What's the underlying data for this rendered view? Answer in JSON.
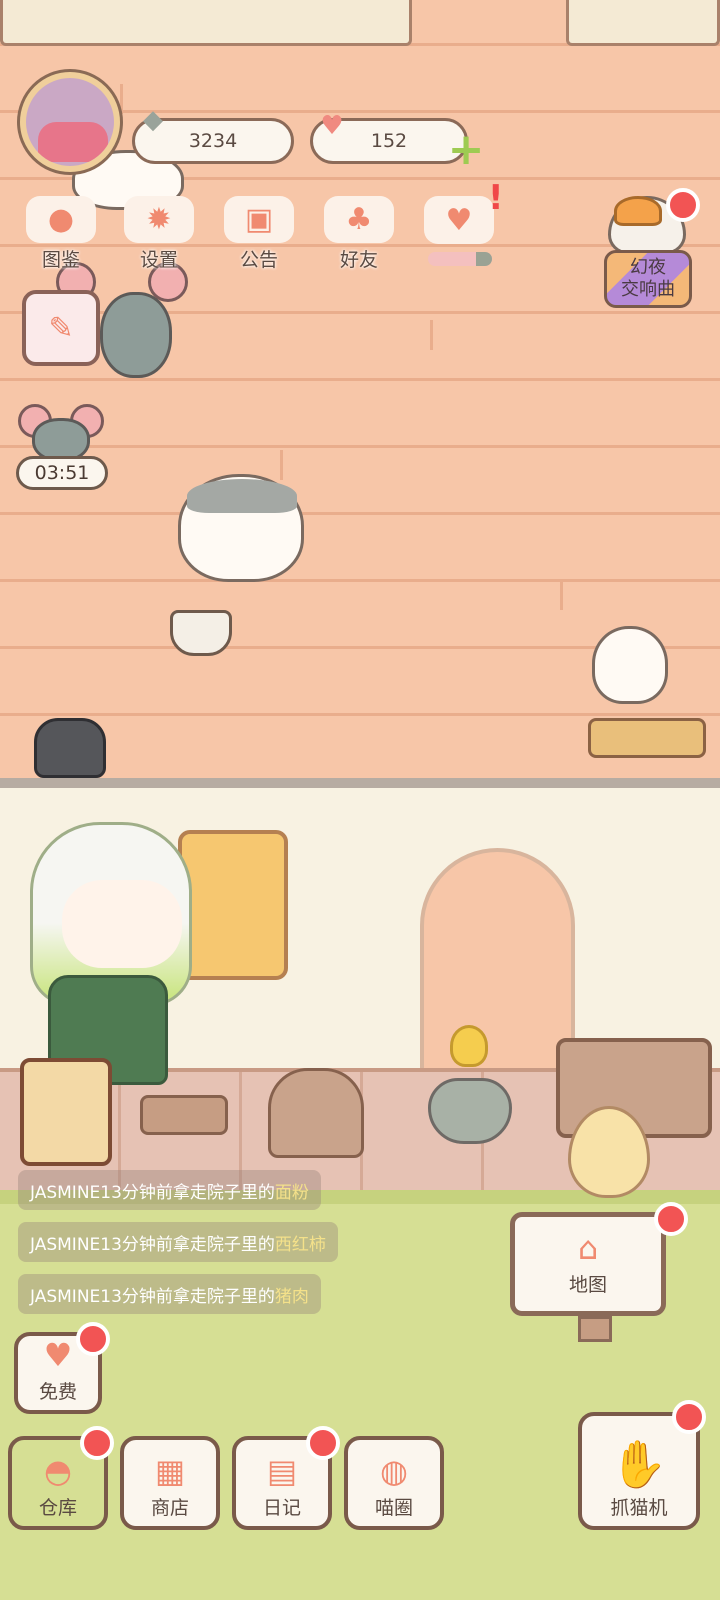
{
  "top_bar": {
    "fish_count": "3234",
    "heart_count": "152",
    "plus_icon": "plus-icon",
    "fish_icon": "fish-icon",
    "heart_icon": "heart-icon"
  },
  "menu": {
    "items": [
      {
        "label": "图鉴",
        "icon": "cat-head-icon"
      },
      {
        "label": "设置",
        "icon": "gear-icon"
      },
      {
        "label": "公告",
        "icon": "gift-icon"
      },
      {
        "label": "好友",
        "icon": "friends-icon"
      },
      {
        "label": "",
        "icon": "heart-event-icon"
      }
    ],
    "event_progress": 0.75,
    "event_alert": "!"
  },
  "event": {
    "label_line1": "幻夜",
    "label_line2": "交响曲"
  },
  "timer": {
    "value": "03:51"
  },
  "messages": [
    {
      "prefix": "JASMINE13分钟前拿走院子里的",
      "item": "面粉"
    },
    {
      "prefix": "JASMINE13分钟前拿走院子里的",
      "item": "西红柿"
    },
    {
      "prefix": "JASMINE13分钟前拿走院子里的",
      "item": "猪肉"
    }
  ],
  "map_sign": {
    "label": "地图",
    "icon": "house-icon"
  },
  "bottom": {
    "free": "免费",
    "warehouse": "仓库",
    "shop": "商店",
    "diary": "日记",
    "circle": "喵圈",
    "claw": "抓猫机"
  },
  "colors": {
    "wall": "#f7c6a8",
    "grass": "#d6df94",
    "accent": "#f08a70",
    "badge": "#f25454",
    "highlight_text": "#f4e18a"
  }
}
